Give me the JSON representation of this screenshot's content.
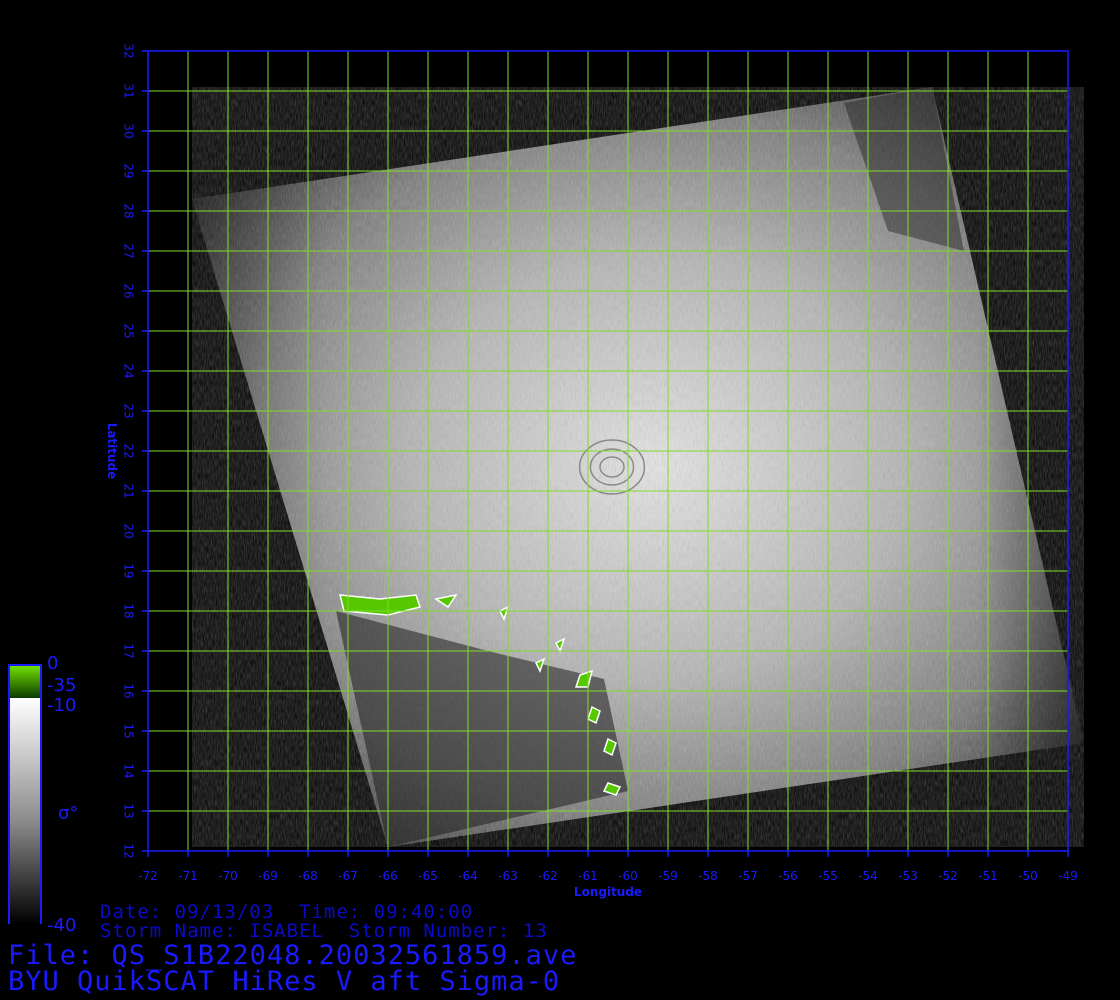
{
  "map": {
    "xlabel": "Longitude",
    "ylabel": "Latitude",
    "lon_range": [
      -72,
      -49
    ],
    "lat_range": [
      12,
      32
    ],
    "lon_ticks": [
      "-72",
      "-71",
      "-70",
      "-69",
      "-68",
      "-67",
      "-66",
      "-65",
      "-64",
      "-63",
      "-62",
      "-61",
      "-60",
      "-59",
      "-58",
      "-57",
      "-56",
      "-55",
      "-54",
      "-53",
      "-52",
      "-51",
      "-50",
      "-49"
    ],
    "lat_ticks": [
      "12",
      "13",
      "14",
      "15",
      "16",
      "17",
      "18",
      "19",
      "20",
      "21",
      "22",
      "23",
      "24",
      "25",
      "26",
      "27",
      "28",
      "29",
      "30",
      "31",
      "32"
    ],
    "grid": true,
    "grid_color": "#7ddc2a",
    "axis_color": "#1a1aff",
    "swath_corners_lonlat": [
      [
        -70.9,
        28.3
      ],
      [
        -52.4,
        31.1
      ],
      [
        -48.6,
        14.7
      ],
      [
        -66.0,
        12.1
      ]
    ],
    "storm_eye_lonlat": [
      -60.4,
      21.6
    ],
    "land_mask_color": "#55c800"
  },
  "colorbar": {
    "label_0": "0",
    "label_m35": "-35",
    "label_m10": "-10",
    "label_sigma": "σ°",
    "label_m40": "-40",
    "green_color": "#55c800"
  },
  "info": {
    "date_line": "Date: 09/13/03  Time: 09:40:00",
    "storm_line": "Storm Name: ISABEL  Storm Number: 13",
    "file_line": "File: QS_S1B22048.20032561859.ave",
    "title_line": "BYU QuikSCAT HiRes V aft Sigma-0"
  }
}
